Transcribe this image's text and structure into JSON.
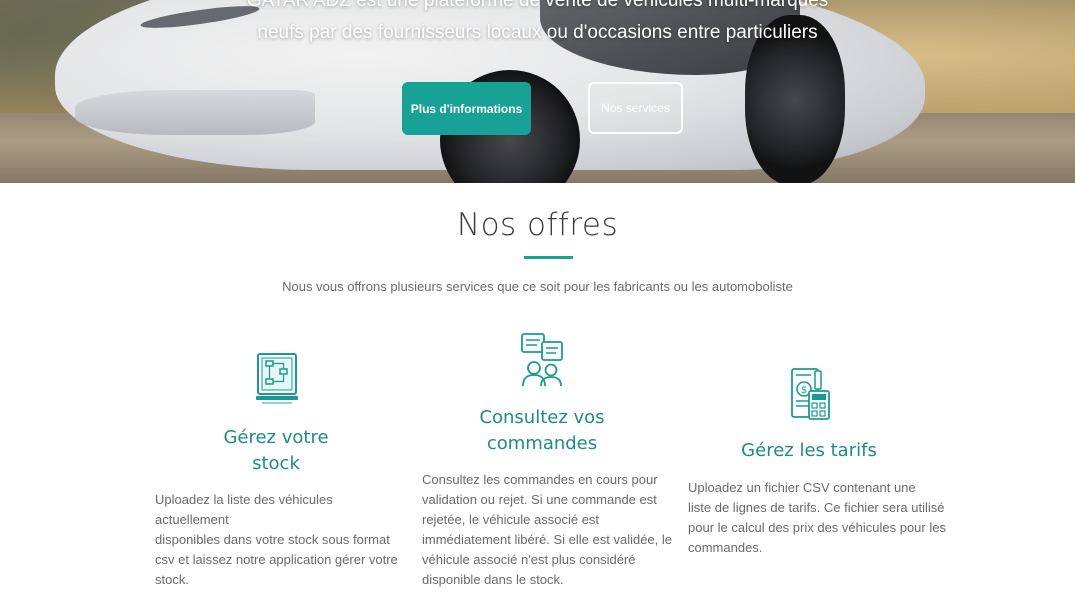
{
  "hero": {
    "line1": "GATAR'ADZ est une plateforme de vente de véhicules multi-marques",
    "line2": "neufs par des fournisseurs locaux ou d'occasions entre particuliers",
    "primary_button": "Plus d'informations",
    "secondary_button": "Nos services"
  },
  "offers": {
    "title": "Nos offres",
    "subtitle": "Nous vous offrons plusieurs services que ce soit pour les fabricants ou les automoboliste",
    "cards": [
      {
        "icon": "flowchart-board-icon",
        "title_line1": "Gérez votre",
        "title_line2": "stock",
        "description": [
          "Uploadez la liste des véhicules actuellement",
          "disponibles dans votre stock sous format",
          "csv et laissez notre application gérer votre",
          "stock."
        ]
      },
      {
        "icon": "people-chat-icon",
        "title_line1": "Consultez vos",
        "title_line2": "commandes",
        "description": [
          "Consultez les commandes en cours pour",
          "validation ou rejet. Si une commande est",
          "rejetée, le véhicule associé est",
          "immédiatement libéré. Si elle est validée, le",
          "véhicule associé n'est plus considéré",
          "disponible dans le stock."
        ]
      },
      {
        "icon": "invoice-calculator-icon",
        "title_line1": "Gérez les tarifs",
        "description": [
          "Uploadez un fichier CSV contenant une",
          "liste de lignes de tarifs. Ce fichier sera utilisé",
          "pour le calcul des prix des véhicules pour les",
          "commandes."
        ]
      }
    ]
  },
  "colors": {
    "accent": "#17a295",
    "title_teal": "#1d8c86",
    "icon_teal": "#1a9a95"
  }
}
